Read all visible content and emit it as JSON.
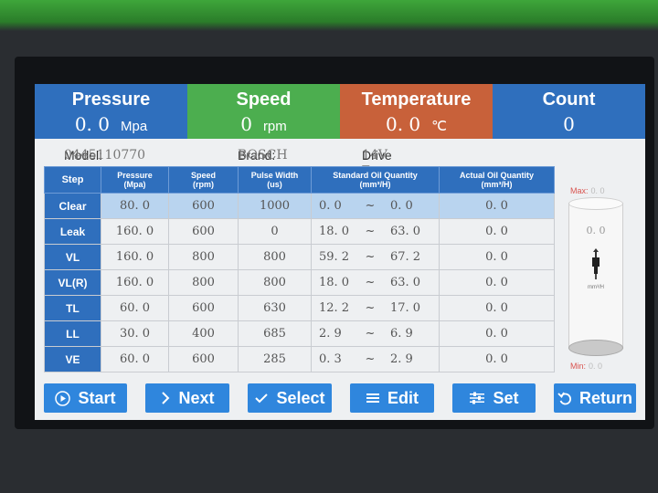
{
  "header": [
    {
      "title": "Pressure",
      "value": "0. 0",
      "unit": "Mpa",
      "color": "#2f6fbd"
    },
    {
      "title": "Speed",
      "value": "0",
      "unit": "rpm",
      "color": "#4caf50"
    },
    {
      "title": "Temperature",
      "value": "0. 0",
      "unit": "℃",
      "color": "#c8613a"
    },
    {
      "title": "Count",
      "value": "0",
      "unit": "",
      "color": "#2f6fbd"
    }
  ],
  "info": {
    "model_label": "Model:",
    "model_value": "0445110770",
    "brand_label": "Brand:",
    "brand_value": "BOSCH",
    "drive_label": "Drive Type:",
    "drive_value": "14V"
  },
  "table": {
    "columns": [
      "Step",
      "Pressure\n(Mpa)",
      "Speed\n(rpm)",
      "Pulse Width\n(us)",
      "Standard Oil Quantity\n(mm³/H)",
      "Actual Oil Quantity\n(mm³/H)"
    ],
    "tilde": "~",
    "rows": [
      {
        "step": "Clear",
        "pressure": "80. 0",
        "speed": "600",
        "pulse": "1000",
        "std_min": "0. 0",
        "std_max": "0. 0",
        "actual": "0. 0"
      },
      {
        "step": "Leak",
        "pressure": "160. 0",
        "speed": "600",
        "pulse": "0",
        "std_min": "18. 0",
        "std_max": "63. 0",
        "actual": "0. 0"
      },
      {
        "step": "VL",
        "pressure": "160. 0",
        "speed": "800",
        "pulse": "800",
        "std_min": "59. 2",
        "std_max": "67. 2",
        "actual": "0. 0"
      },
      {
        "step": "VL(R)",
        "pressure": "160. 0",
        "speed": "800",
        "pulse": "800",
        "std_min": "18. 0",
        "std_max": "63. 0",
        "actual": "0. 0"
      },
      {
        "step": "TL",
        "pressure": "60. 0",
        "speed": "600",
        "pulse": "630",
        "std_min": "12. 2",
        "std_max": "17. 0",
        "actual": "0. 0"
      },
      {
        "step": "LL",
        "pressure": "30. 0",
        "speed": "400",
        "pulse": "685",
        "std_min": "2. 9",
        "std_max": "6. 9",
        "actual": "0. 0"
      },
      {
        "step": "VE",
        "pressure": "60. 0",
        "speed": "600",
        "pulse": "285",
        "std_min": "0. 3",
        "std_max": "2. 9",
        "actual": "0. 0"
      }
    ]
  },
  "gauge": {
    "max_label": "Max:",
    "max_value": "0. 0",
    "min_label": "Min:",
    "min_value": "0. 0",
    "reading": "0. 0",
    "unit": "mm³/H"
  },
  "buttons": [
    {
      "label": "Start",
      "icon": "play-circle-icon",
      "glyph": "⊙"
    },
    {
      "label": "Next",
      "icon": "chevron-right-icon",
      "glyph": "›"
    },
    {
      "label": "Select",
      "icon": "check-icon",
      "glyph": "✓"
    },
    {
      "label": "Edit",
      "icon": "menu-icon",
      "glyph": "≡"
    },
    {
      "label": "Set",
      "icon": "sliders-icon",
      "glyph": "⚌"
    },
    {
      "label": "Return",
      "icon": "return-icon",
      "glyph": "↺"
    }
  ]
}
